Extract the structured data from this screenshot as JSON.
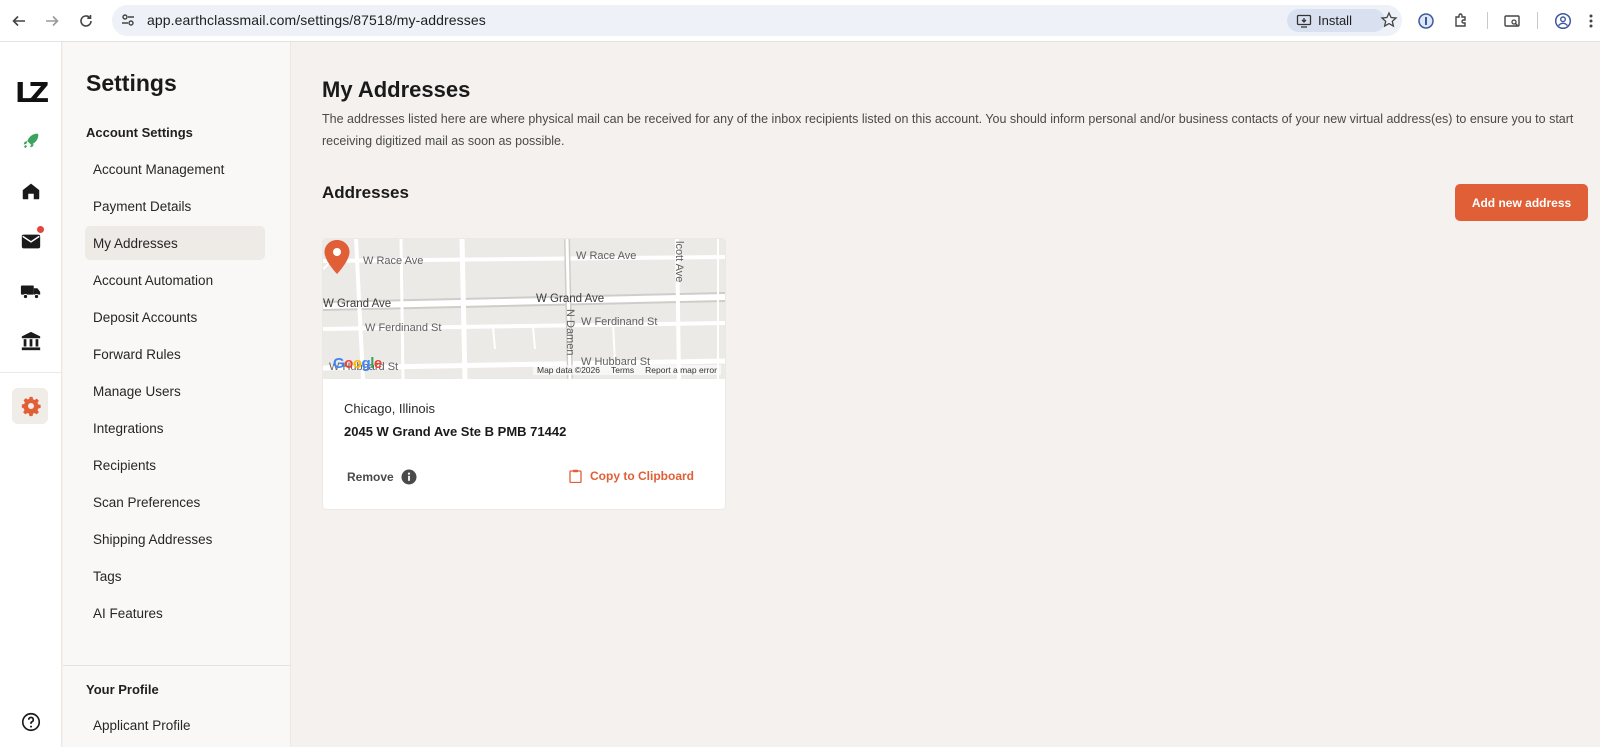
{
  "browser": {
    "url": "app.earthclassmail.com/settings/87518/my-addresses",
    "install_label": "Install"
  },
  "rail": {
    "logo": "LZ",
    "icons": [
      "rocket-icon",
      "home-icon",
      "mail-icon",
      "truck-icon",
      "bank-icon",
      "gear-icon",
      "help-icon"
    ],
    "accent": "#e05f36"
  },
  "sidebar": {
    "title": "Settings",
    "section_account": "Account Settings",
    "items": [
      {
        "label": "Account Management"
      },
      {
        "label": "Payment Details"
      },
      {
        "label": "My Addresses"
      },
      {
        "label": "Account Automation"
      },
      {
        "label": "Deposit Accounts"
      },
      {
        "label": "Forward Rules"
      },
      {
        "label": "Manage Users"
      },
      {
        "label": "Integrations"
      },
      {
        "label": "Recipients"
      },
      {
        "label": "Scan Preferences"
      },
      {
        "label": "Shipping Addresses"
      },
      {
        "label": "Tags"
      },
      {
        "label": "AI Features"
      }
    ],
    "active_item": "My Addresses",
    "section_profile": "Your Profile",
    "profile_items": [
      {
        "label": "Applicant Profile"
      }
    ]
  },
  "main": {
    "title": "My Addresses",
    "description": "The addresses listed here are where physical mail can be received for any of the inbox recipients listed on this account. You should inform personal and/or business contacts of your new virtual address(es) to ensure you to start receiving digitized mail as soon as possible.",
    "section_title": "Addresses",
    "add_button": "Add new address"
  },
  "address_card": {
    "map": {
      "streets": {
        "race_left": "W Race Ave",
        "race_right": "W Race Ave",
        "grand_left": "W Grand Ave",
        "grand_right": "W Grand Ave",
        "ferdinand_left": "W Ferdinand St",
        "ferdinand_right": "W Ferdinand St",
        "hubbard_left": "W Hubbard St",
        "hubbard_right": "W Hubbard St",
        "damen": "N Damen",
        "wolcott": "lcott Ave"
      },
      "attribution": "Map data ©2026",
      "terms": "Terms",
      "report": "Report a map error",
      "google": "Google"
    },
    "city": "Chicago, Illinois",
    "address": "2045 W Grand Ave Ste B PMB 71442",
    "remove_label": "Remove",
    "copy_label": "Copy to Clipboard"
  }
}
